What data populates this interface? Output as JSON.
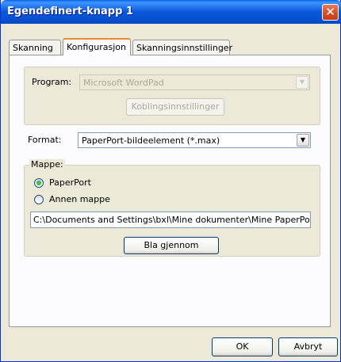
{
  "window": {
    "title": "Egendefinert-knapp 1",
    "close_label": "✕"
  },
  "tabs": [
    {
      "label": "Skanning",
      "active": false
    },
    {
      "label": "Konfigurasjon",
      "active": true
    },
    {
      "label": "Skanningsinnstillinger",
      "active": false
    }
  ],
  "program": {
    "label": "Program:",
    "value": "Microsoft WordPad",
    "enabled": false,
    "settings_button": "Koblingsinnstillinger"
  },
  "format": {
    "label": "Format:",
    "value": "PaperPort-bildeelement (*.max)"
  },
  "folder": {
    "legend": "Mappe:",
    "options": [
      {
        "label": "PaperPort",
        "selected": true
      },
      {
        "label": "Annen mappe",
        "selected": false
      }
    ],
    "path": "C:\\Documents and Settings\\bxl\\Mine dokumenter\\Mine PaperPort-do",
    "browse_button": "Bla gjennom"
  },
  "footer": {
    "ok_label": "OK",
    "cancel_label": "Avbryt"
  },
  "icons": {
    "dropdown": "chevron-down-icon",
    "close": "close-icon"
  },
  "colors": {
    "titlebar": "#0a58d8",
    "face": "#ece9d8",
    "panel": "#fcfcfe",
    "tab_highlight": "#e68b2c",
    "radio_dot": "#21a121"
  }
}
